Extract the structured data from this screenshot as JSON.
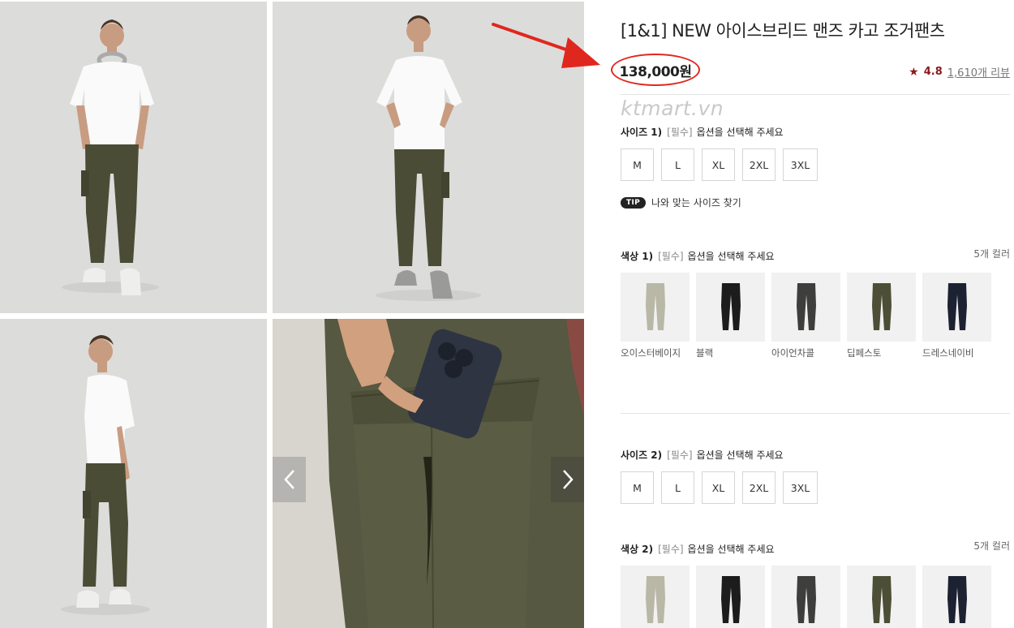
{
  "product": {
    "title": "[1&1] NEW 아이스브리드 맨즈 카고 조거팬츠",
    "price": "138,000원",
    "rating": "4.8",
    "review_link": "1,610개 리뷰",
    "watermark": "ktmart.vn"
  },
  "gallery": {
    "prev_icon": "chevron-left-icon",
    "next_icon": "chevron-right-icon"
  },
  "option_sets": [
    {
      "size_label": "사이즈 1)",
      "size_required": "[필수]",
      "size_prompt": "옵션을 선택해 주세요",
      "sizes": [
        "M",
        "L",
        "XL",
        "2XL",
        "3XL"
      ],
      "tip_badge": "TIP",
      "tip_text": "나와 맞는 사이즈 찾기",
      "color_label": "색상 1)",
      "color_required": "[필수]",
      "color_prompt": "옵션을 선택해 주세요",
      "color_count": "5개 컬러",
      "colors": [
        {
          "name": "오이스터베이지",
          "hex": "#b9b7a6"
        },
        {
          "name": "블랙",
          "hex": "#1c1c1c"
        },
        {
          "name": "아이언차콜",
          "hex": "#3e3e3c"
        },
        {
          "name": "딥페스토",
          "hex": "#4c4f36"
        },
        {
          "name": "드레스네이비",
          "hex": "#1d2233"
        }
      ]
    },
    {
      "size_label": "사이즈 2)",
      "size_required": "[필수]",
      "size_prompt": "옵션을 선택해 주세요",
      "sizes": [
        "M",
        "L",
        "XL",
        "2XL",
        "3XL"
      ],
      "color_label": "색상 2)",
      "color_required": "[필수]",
      "color_prompt": "옵션을 선택해 주세요",
      "color_count": "5개 컬러",
      "colors": [
        {
          "hex": "#b9b7a6"
        },
        {
          "hex": "#1c1c1c"
        },
        {
          "hex": "#3e3e3c"
        },
        {
          "hex": "#4c4f36"
        },
        {
          "hex": "#1d2233"
        }
      ]
    }
  ],
  "colors": {
    "accent": "#8b1a1a",
    "annotation": "#e0271e",
    "pants": "#4b4c35",
    "shirt": "#fafafa"
  }
}
